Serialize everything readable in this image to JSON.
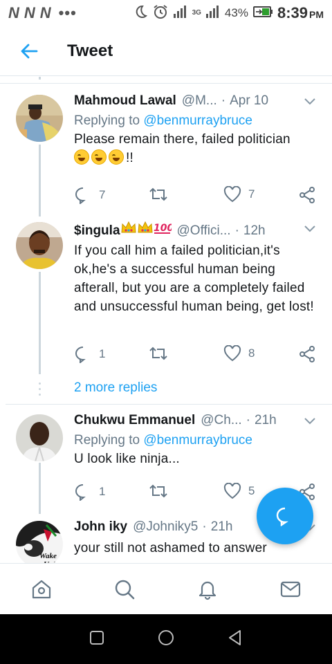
{
  "status_bar": {
    "notification_letters": [
      "N",
      "N",
      "N"
    ],
    "dots": "•••",
    "network": "3G",
    "battery": "43%",
    "time": "8:39",
    "ampm": "PM"
  },
  "header": {
    "title": "Tweet"
  },
  "tweets": [
    {
      "name": "Mahmoud Lawal",
      "handle": "@M...",
      "time": "Apr 10",
      "replying_prefix": "Replying to",
      "replying_to": "@benmurraybruce",
      "text": "Please remain there, failed politician",
      "text_suffix": "!!",
      "replies": "7",
      "retweets": "",
      "likes": "7"
    },
    {
      "name": "$ingula",
      "handle": "@Offici...",
      "time": "12h",
      "text": "If you call him a failed politician,it's ok,he's a successful human being afterall, but you are a completely failed and unsuccessful human being, get lost!",
      "replies": "1",
      "retweets": "",
      "likes": "8"
    },
    {
      "name": "Chukwu Emmanuel",
      "handle": "@Ch...",
      "time": "21h",
      "replying_prefix": "Replying to",
      "replying_to": "@benmurraybruce",
      "text": "U look like ninja...",
      "replies": "1",
      "retweets": "",
      "likes": "5"
    },
    {
      "name": "John iky",
      "handle": "@Johniky5",
      "time": "21h",
      "text": "your still not ashamed to answer",
      "avatar_text": "Wake Up!!"
    }
  ],
  "more_replies": "2 more replies",
  "colors": {
    "accent": "#1da1f2",
    "secondary_text": "#657786",
    "divider": "#e1e8ed",
    "like_icon": "#e0245e"
  }
}
